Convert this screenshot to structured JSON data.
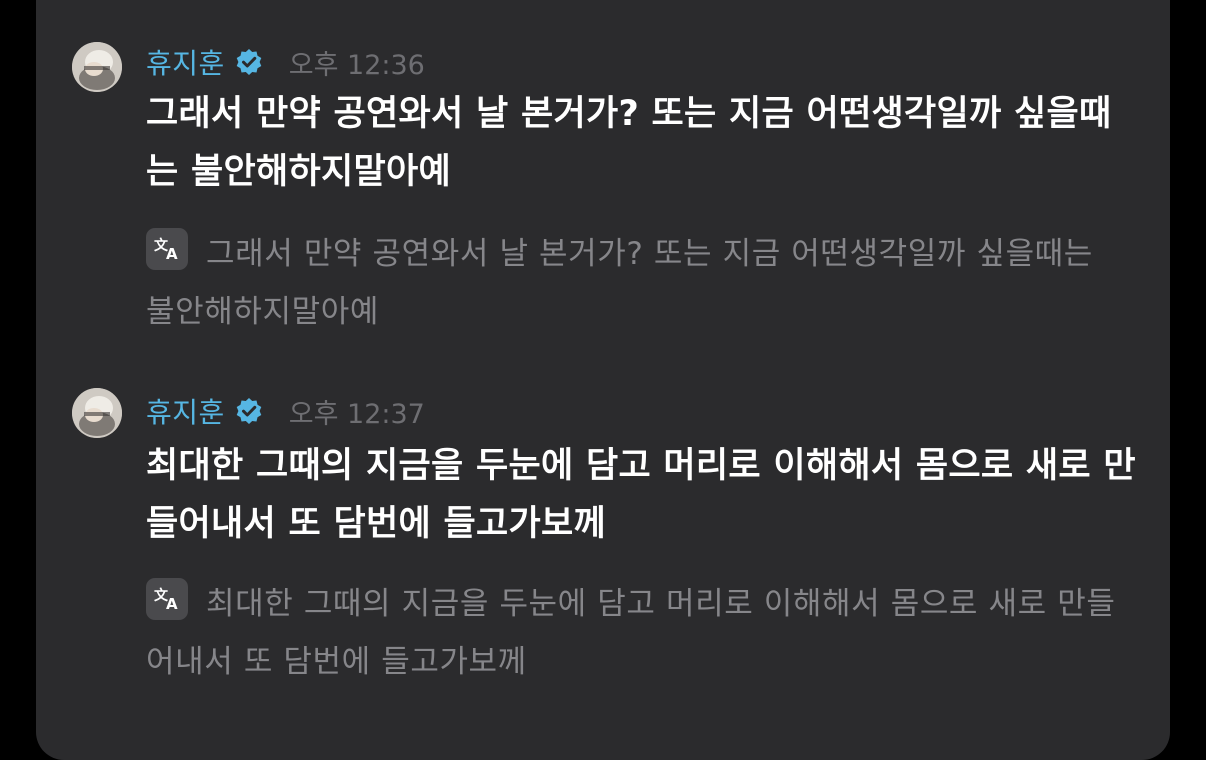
{
  "colors": {
    "background": "#000000",
    "panel": "#2b2b2d",
    "name": "#56b6e3",
    "verified_badge": "#56b6e3",
    "time": "#6e6e72",
    "message_text": "#ffffff",
    "translation_text": "#86868a",
    "translate_icon_bg": "#4a4a4d"
  },
  "messages": [
    {
      "author": "휴지훈",
      "verified_icon": "verified-badge-icon",
      "time": "오후 12:36",
      "text": "그래서 만약 공연와서 날 본거가? 또는 지금 어떤생각일까 싶을때는 불안해하지말아예",
      "translate_icon": "translate-icon",
      "translation": "그래서 만약 공연와서 날 본거가? 또는 지금 어떤생각일까 싶을때는 불안해하지말아예"
    },
    {
      "author": "휴지훈",
      "verified_icon": "verified-badge-icon",
      "time": "오후 12:37",
      "text": "최대한 그때의 지금을 두눈에 담고 머리로 이해해서 몸으로 새로 만들어내서 또 담번에 들고가보께",
      "translate_icon": "translate-icon",
      "translation": "최대한 그때의 지금을 두눈에 담고 머리로 이해해서 몸으로 새로 만들어내서 또 담번에 들고가보께"
    }
  ]
}
